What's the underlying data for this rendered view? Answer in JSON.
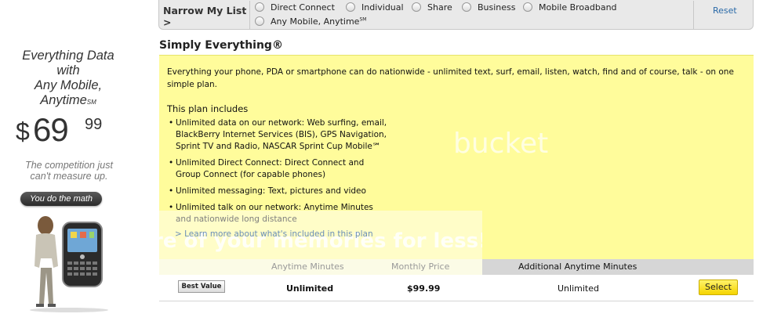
{
  "promo": {
    "headline_line1": "Everything Data",
    "headline_line2": "with",
    "headline_line3": "Any Mobile,",
    "headline_line4": "Anytime",
    "headline_mark": "SM",
    "price_symbol": "$",
    "price_whole": "69",
    "price_cents": "99",
    "tagline_line1": "The competition just",
    "tagline_line2": "can't measure up.",
    "math_button": "You do the math"
  },
  "filter": {
    "label": "Narrow My List >",
    "options": [
      {
        "label": "Direct Connect"
      },
      {
        "label": "Individual"
      },
      {
        "label": "Share"
      },
      {
        "label": "Business"
      },
      {
        "label": "Mobile Broadband"
      },
      {
        "label": "Any Mobile, Anytime",
        "mark": "SM"
      }
    ],
    "reset": "Reset"
  },
  "plan": {
    "title": "Simply Everything®",
    "description": "Everything your phone, PDA or smartphone can do nationwide - unlimited text, surf, email, listen, watch, find and of course, talk - on one simple plan.",
    "includes_title": "This plan includes",
    "includes": [
      "Unlimited data on our network: Web surfing, email, BlackBerry Internet Services (BIS), GPS Navigation, Sprint TV and Radio, NASCAR Sprint Cup Mobile℠",
      "Unlimited Direct Connect: Direct Connect and Group Connect (for capable phones)",
      "Unlimited messaging: Text, pictures and video",
      "Unlimited talk on our network: Anytime Minutes and nationwide long distance"
    ],
    "learn_more": "> Learn more about what's included in this plan",
    "watermark_text": "re of your memories for less!",
    "watermark_brand": "bucket"
  },
  "table": {
    "headers": {
      "anytime": "Anytime Minutes",
      "monthly": "Monthly Price",
      "additional": "Additional Anytime Minutes"
    },
    "row": {
      "badge": "Best Value",
      "anytime": "Unlimited",
      "monthly": "$99.99",
      "additional": "Unlimited",
      "select": "Select"
    }
  },
  "colors": {
    "plan_panel": "#fffc9b",
    "select_button": "#f5d400",
    "reset_link": "#2a6aa8"
  }
}
